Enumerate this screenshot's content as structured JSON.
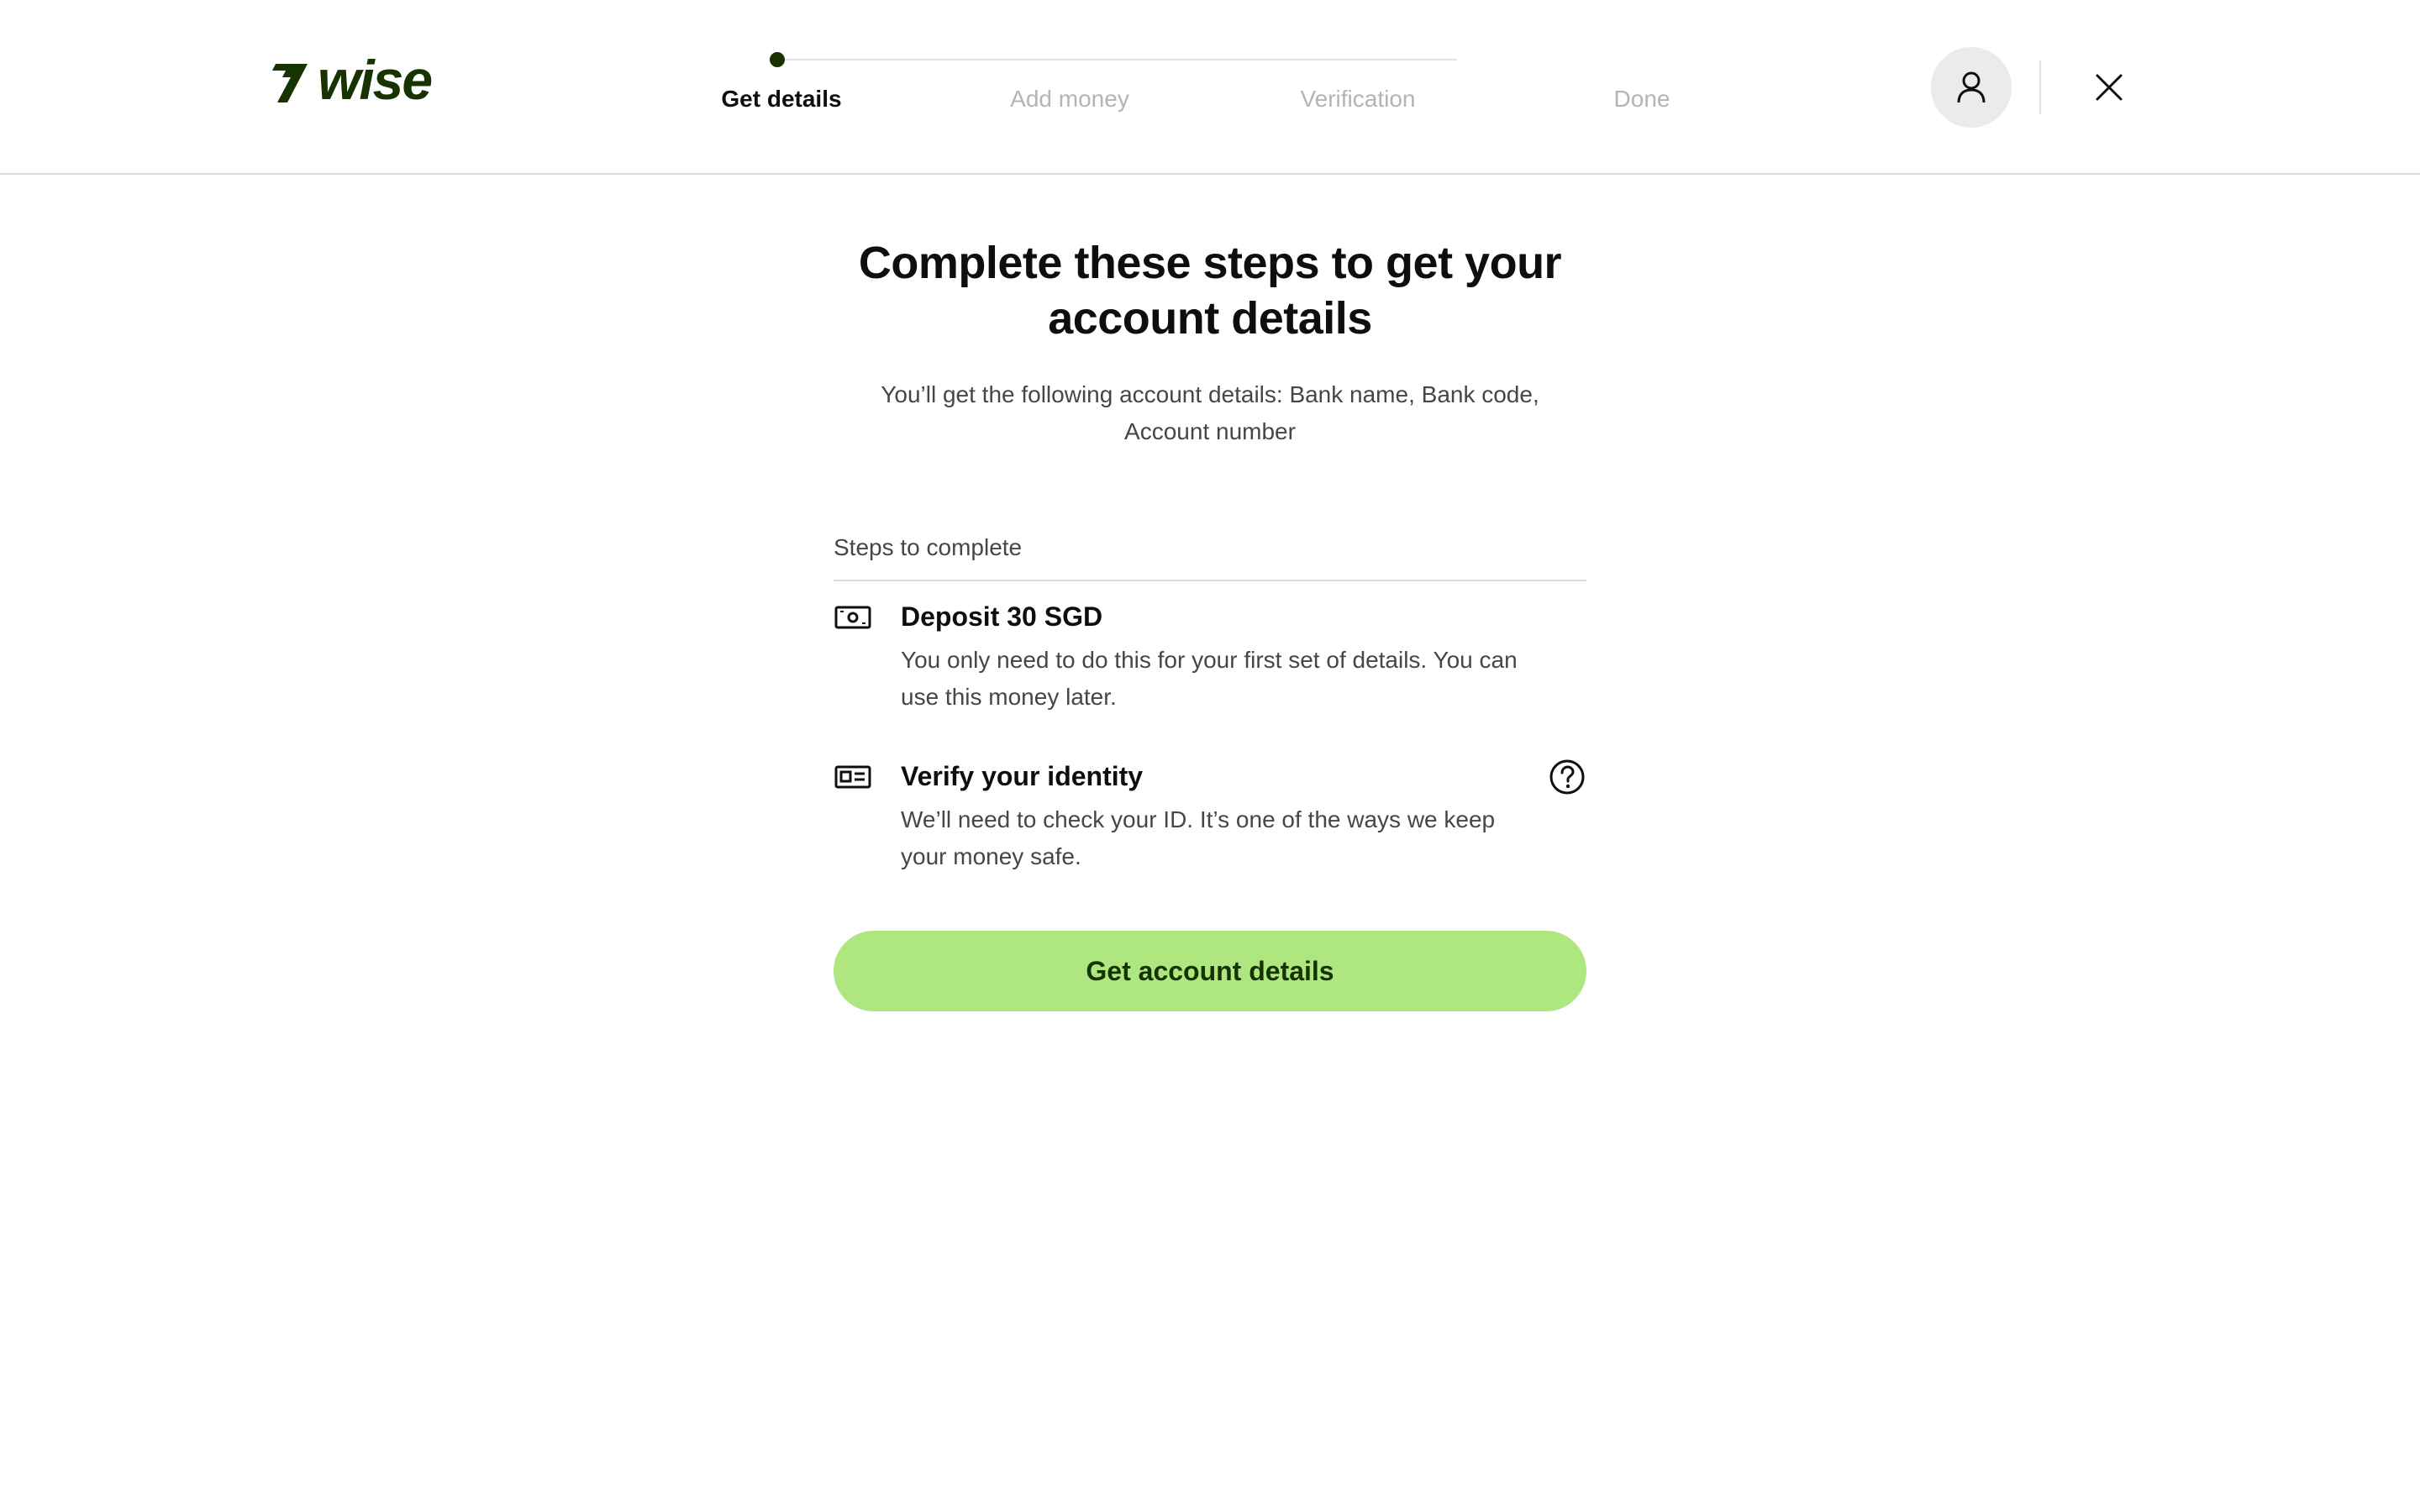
{
  "brand": {
    "name": "wise",
    "logo_color": "#163300"
  },
  "stepper": {
    "steps": [
      {
        "label": "Get details",
        "state": "active"
      },
      {
        "label": "Add money",
        "state": "upcoming"
      },
      {
        "label": "Verification",
        "state": "upcoming"
      },
      {
        "label": "Done",
        "state": "upcoming"
      }
    ]
  },
  "header_actions": {
    "profile_icon": "person-icon",
    "close_icon": "close-icon"
  },
  "main": {
    "title": "Complete these steps to get your account details",
    "subtitle": "You’ll get the following account details: Bank name, Bank code, Account number",
    "steps_heading": "Steps to complete",
    "steps": [
      {
        "icon": "cash-icon",
        "title": "Deposit 30 SGD",
        "description": "You only need to do this for your first set of details. You can use this money later."
      },
      {
        "icon": "id-card-icon",
        "title": "Verify your identity",
        "description": "We’ll need to check your ID. It’s one of the ways we keep your money safe.",
        "help_icon": "question-circle-icon"
      }
    ],
    "cta_label": "Get account details"
  },
  "colors": {
    "accent": "#aee77f",
    "accent_text": "#163300",
    "text_primary": "#0e0f0c",
    "text_secondary": "#454745",
    "text_muted": "#b4b4b4"
  }
}
